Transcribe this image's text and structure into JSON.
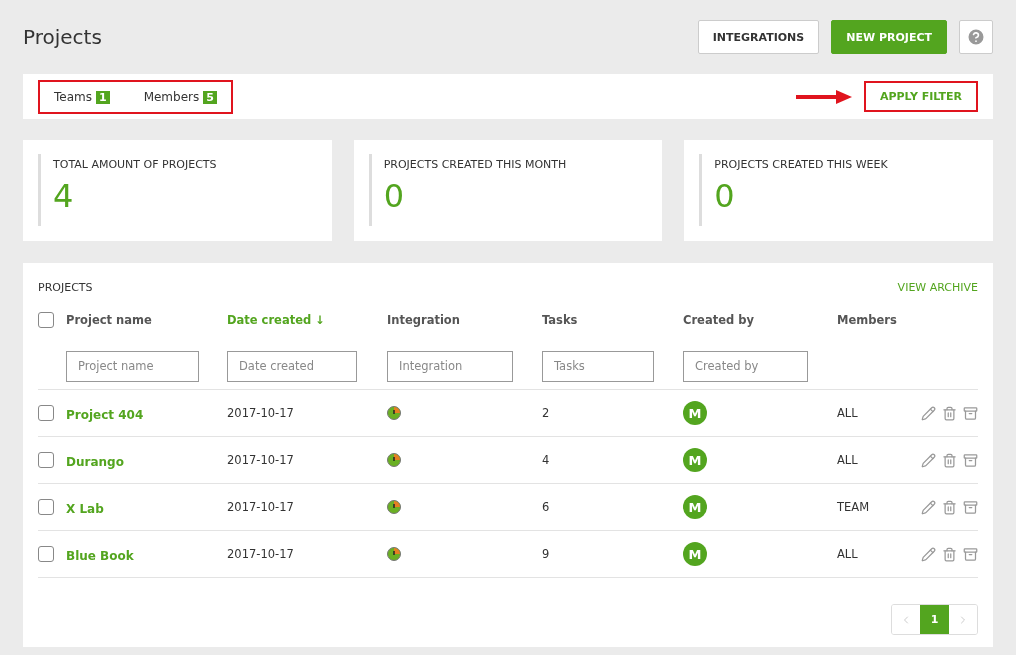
{
  "header": {
    "title": "Projects",
    "buttons": [
      {
        "label": "INTEGRATIONS",
        "kind": "outline"
      },
      {
        "label": "NEW PROJECT",
        "kind": "primary"
      }
    ]
  },
  "filter_bar": {
    "filters": [
      {
        "label": "Teams",
        "count": "1"
      },
      {
        "label": "Members",
        "count": "5"
      }
    ],
    "apply": "APPLY FILTER"
  },
  "stats": [
    {
      "label": "TOTAL AMOUNT OF PROJECTS",
      "value": "4"
    },
    {
      "label": "PROJECTS CREATED THIS MONTH",
      "value": "0"
    },
    {
      "label": "PROJECTS CREATED THIS WEEK",
      "value": "0"
    }
  ],
  "table": {
    "title": "PROJECTS",
    "archive_link": "VIEW ARCHIVE",
    "select_all": {
      "checked": false
    },
    "columns": [
      {
        "label": "Project name",
        "placeholder": "Project name",
        "sorted": false
      },
      {
        "label": "Date created",
        "placeholder": "Date created",
        "sorted": true,
        "sort_icon": "↓"
      },
      {
        "label": "Integration",
        "placeholder": "Integration",
        "sorted": false
      },
      {
        "label": "Tasks",
        "placeholder": "Tasks",
        "sorted": false
      },
      {
        "label": "Created by",
        "placeholder": "Created by",
        "sorted": false
      },
      {
        "label": "Members",
        "sorted": false
      }
    ],
    "rows": [
      {
        "checked": false,
        "name": "Project 404",
        "date": "2017-10-17",
        "tasks": "2",
        "creator": "M",
        "members": "ALL"
      },
      {
        "checked": false,
        "name": "Durango",
        "date": "2017-10-17",
        "tasks": "4",
        "creator": "M",
        "members": "ALL"
      },
      {
        "checked": false,
        "name": "X Lab",
        "date": "2017-10-17",
        "tasks": "6",
        "creator": "M",
        "members": "TEAM"
      },
      {
        "checked": false,
        "name": "Blue Book",
        "date": "2017-10-17",
        "tasks": "9",
        "creator": "M",
        "members": "ALL"
      }
    ],
    "pagination": [
      {
        "label": "1",
        "selected": true
      }
    ]
  }
}
